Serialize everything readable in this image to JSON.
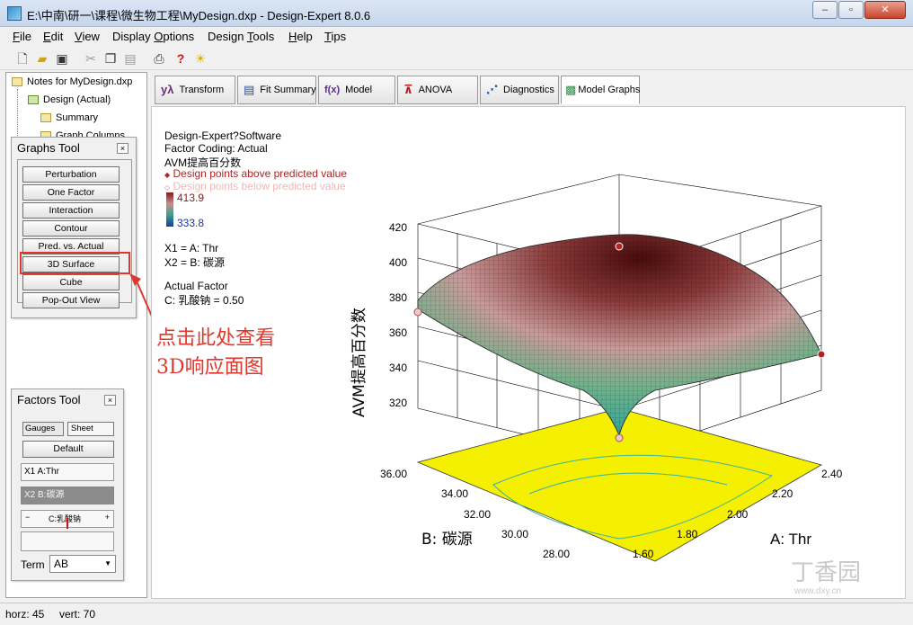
{
  "window": {
    "title": "E:\\中南\\研一\\课程\\微生物工程\\MyDesign.dxp - Design-Expert 8.0.6",
    "min": "–",
    "max": "▫",
    "close": "✕"
  },
  "menu": [
    {
      "key": "F",
      "rest": "ile"
    },
    {
      "key": "E",
      "rest": "dit"
    },
    {
      "key": "V",
      "rest": "iew"
    },
    {
      "key": "",
      "rest": "Display ",
      "key2": "O",
      "rest2": "ptions"
    },
    {
      "key": "",
      "rest": "Design ",
      "key2": "T",
      "rest2": "ools"
    },
    {
      "key": "H",
      "rest": "elp"
    },
    {
      "key": "",
      "rest": "",
      "key2": "T",
      "rest2": "ips"
    }
  ],
  "menu_labels": [
    "File",
    "Edit",
    "View",
    "Display Options",
    "Design Tools",
    "Help",
    "Tips"
  ],
  "toolbar_icons": [
    "new-file-icon",
    "open-folder-icon",
    "save-icon",
    "cut-icon",
    "copy-icon",
    "paste-icon",
    "print-icon",
    "help-icon",
    "tip-bulb-icon"
  ],
  "tree": {
    "root": "Notes for MyDesign.dxp",
    "design": "Design (Actual)",
    "summary": "Summary",
    "graph_columns": "Graph Columns"
  },
  "graphs_tool": {
    "title": "Graphs Tool",
    "close": "×",
    "buttons": [
      "Perturbation",
      "One Factor",
      "Interaction",
      "Contour",
      "Pred. vs. Actual",
      "3D Surface",
      "Cube",
      "Pop-Out View"
    ]
  },
  "factors_tool": {
    "title": "Factors Tool",
    "close": "×",
    "gauges": "Gauges",
    "sheet": "Sheet",
    "default": "Default",
    "x1": "X1",
    "x1_label": "A:Thr",
    "x2": "X2",
    "x2_label": "B:碳源",
    "c_label": "C:乳酸钠",
    "minus": "−",
    "plus": "+",
    "term_label": "Term",
    "term_value": "AB"
  },
  "tabs": [
    {
      "icon": "yλ",
      "label": "Transform"
    },
    {
      "icon": "▤",
      "label": "Fit Summary"
    },
    {
      "icon": "f(x)",
      "label": "Model"
    },
    {
      "icon": "⊼",
      "label": "ANOVA"
    },
    {
      "icon": "⋰",
      "label": "Diagnostics"
    },
    {
      "icon": "▩",
      "label": "Model Graphs"
    }
  ],
  "legend": {
    "software": "Design-Expert?Software",
    "coding": "Factor Coding: Actual",
    "response": "AVM提高百分数",
    "above": "Design points above predicted value",
    "below": "Design points below predicted value",
    "max": "413.9",
    "min": "333.8",
    "x1": "X1 = A: Thr",
    "x2": "X2 = B: 碳源",
    "actual_factor": "Actual Factor",
    "c_value": "C: 乳酸钠 = 0.50"
  },
  "chart_data": {
    "type": "surface",
    "zlabel": "AVM提高百分数",
    "xlabel": "A: Thr",
    "ylabel": "B: 碳源",
    "z_ticks": [
      "420",
      "400",
      "380",
      "360",
      "340",
      "320"
    ],
    "x_ticks": [
      "1.60",
      "1.80",
      "2.00",
      "2.20",
      "2.40"
    ],
    "y_ticks": [
      "28.00",
      "30.00",
      "32.00",
      "34.00",
      "36.00"
    ],
    "zlim": [
      320,
      420
    ],
    "xlim": [
      1.6,
      2.4
    ],
    "ylim": [
      28,
      36
    ],
    "colors": {
      "high": "#5a1010",
      "mid": "#c99a9a",
      "low": "#2ea39a",
      "floor": "#f4f000"
    }
  },
  "annotation": {
    "line1": "点击此处查看",
    "line2": "3D响应面图",
    "color": "#e0372d"
  },
  "status": {
    "horz": "horz: 45",
    "vert": "vert: 70"
  },
  "watermark": {
    "brand": "丁香园",
    "url": "www.dxy.cn"
  }
}
